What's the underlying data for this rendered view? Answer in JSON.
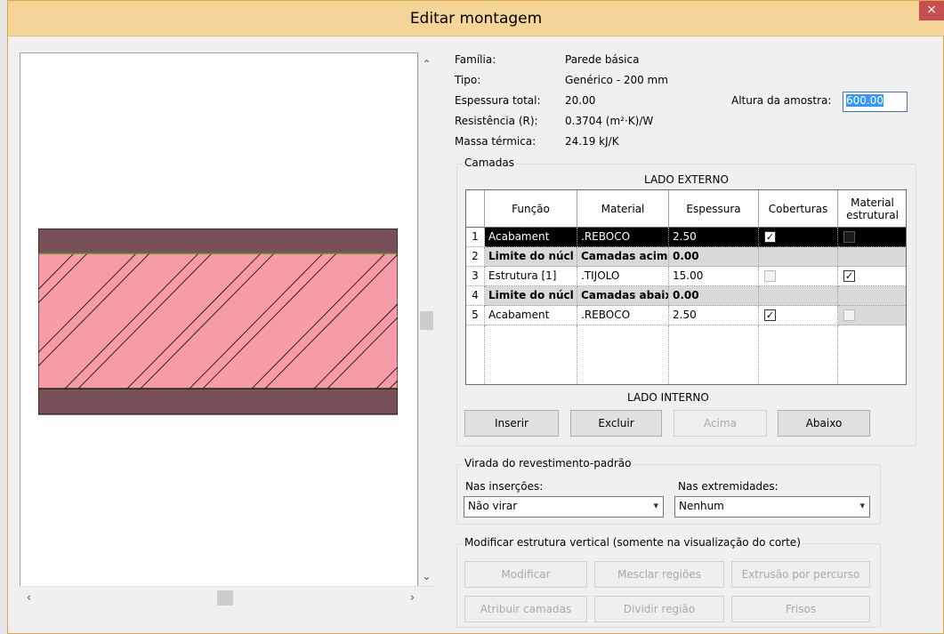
{
  "window": {
    "title": "Editar montagem",
    "close": "×"
  },
  "info": {
    "familia_label": "Família:",
    "familia_value": "Parede básica",
    "tipo_label": "Tipo:",
    "tipo_value": "Genérico - 200 mm",
    "espessura_label": "Espessura total:",
    "espessura_value": "20.00",
    "resistencia_label": "Resistência (R):",
    "resistencia_value": "0.3704 (m²·K)/W",
    "massa_label": "Massa térmica:",
    "massa_value": "24.19 kJ/K",
    "altura_label": "Altura da amostra:",
    "altura_value": "600.00"
  },
  "layers": {
    "legend": "Camadas",
    "top_label": "LADO EXTERNO",
    "bottom_label": "LADO INTERNO",
    "headers": [
      "Função",
      "Material",
      "Espessura",
      "Coberturas",
      "Material estrutural"
    ],
    "rows": [
      {
        "num": "1",
        "funcao": "Acabament",
        "material": ".REBOCO",
        "espessura": "2.50",
        "coberturas": "checked",
        "estrutural": "dark"
      },
      {
        "num": "2",
        "funcao": "Limite do núcl",
        "material": "Camadas acim",
        "espessura": "0.00",
        "coberturas": "none",
        "estrutural": "none"
      },
      {
        "num": "3",
        "funcao": "Estrutura [1]",
        "material": ".TIJOLO",
        "espessura": "15.00",
        "coberturas": "disabled",
        "estrutural": "checked"
      },
      {
        "num": "4",
        "funcao": "Limite do núcl",
        "material": "Camadas abaix",
        "espessura": "0.00",
        "coberturas": "none",
        "estrutural": "none"
      },
      {
        "num": "5",
        "funcao": "Acabament",
        "material": ".REBOCO",
        "espessura": "2.50",
        "coberturas": "checked",
        "estrutural": "disabled"
      }
    ],
    "buttons": {
      "inserir": "Inserir",
      "excluir": "Excluir",
      "acima": "Acima",
      "abaixo": "Abaixo"
    }
  },
  "wrap": {
    "legend": "Virada do revestimento-padrão",
    "insercoes_label": "Nas inserções:",
    "insercoes_value": "Não virar",
    "extremidades_label": "Nas extremidades:",
    "extremidades_value": "Nenhum"
  },
  "vertical": {
    "legend": "Modificar estrutura vertical (somente na visualização do corte)",
    "modificar": "Modificar",
    "mesclar": "Mesclar regiões",
    "extrusao": "Extrusão por percurso",
    "atribuir": "Atribuir camadas",
    "dividir": "Dividir região",
    "frisos": "Frisos"
  },
  "colors": {
    "finish": "#775157",
    "core": "#f59ca6",
    "title_bar": "#f4d497"
  }
}
